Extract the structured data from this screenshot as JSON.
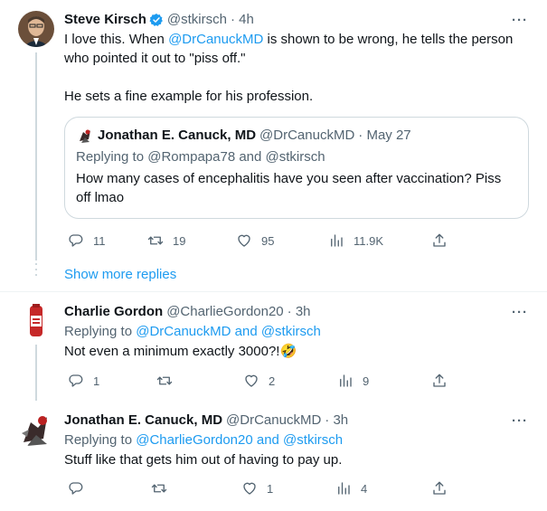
{
  "tweets": {
    "main": {
      "name": "Steve Kirsch",
      "handle": "@stkirsch",
      "time": "· 4h",
      "text_line1_pre": "I love this. When ",
      "text_line1_mention": "@DrCanuckMD",
      "text_line1_post": " is shown to be wrong, he tells the person",
      "text_line2": "who pointed it out to \"piss off.\"",
      "text_line3": "He sets a fine example for his profession.",
      "quote": {
        "name": "Jonathan E. Canuck, MD",
        "handle": "@DrCanuckMD",
        "time": "· May 27",
        "replying_to": "Replying to @Rompapa78 and @stkirsch",
        "text": "How many cases of encephalitis have you seen after vaccination? Piss off lmao"
      },
      "actions": {
        "replies": "11",
        "retweets": "19",
        "likes": "95",
        "views": "11.9K"
      }
    },
    "show_more": "Show more replies",
    "reply1": {
      "name": "Charlie Gordon",
      "handle": "@CharlieGordon20",
      "time": "· 3h",
      "replying_prefix": "Replying to ",
      "replying_links": "@DrCanuckMD and @stkirsch",
      "text": "Not even a minimum exactly 3000?!🤣",
      "actions": {
        "replies": "1",
        "retweets": "",
        "likes": "2",
        "views": "9"
      }
    },
    "reply2": {
      "name": "Jonathan E. Canuck, MD",
      "handle": "@DrCanuckMD",
      "time": "· 3h",
      "replying_prefix": "Replying to ",
      "replying_links": "@CharlieGordon20 and @stkirsch",
      "text": "Stuff like that gets him out of having to pay up.",
      "actions": {
        "replies": "",
        "retweets": "",
        "likes": "1",
        "views": "4"
      }
    }
  },
  "icons": {
    "reply": "reply-icon",
    "retweet": "retweet-icon",
    "like": "heart-icon",
    "views": "views-icon",
    "share": "share-icon",
    "verified": "verified-badge-icon",
    "more": "more-icon"
  },
  "colors": {
    "link": "#1d9bf0",
    "secondary": "#536471",
    "border": "#cfd9de"
  }
}
